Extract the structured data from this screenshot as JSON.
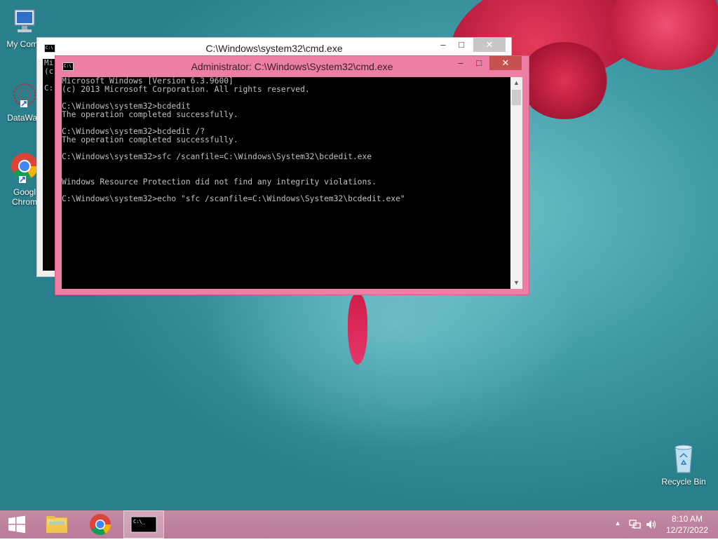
{
  "desktop": {
    "icons": [
      {
        "id": "my-computer",
        "label": "My Comp"
      },
      {
        "id": "datawag",
        "label": "DataWag"
      },
      {
        "id": "google-chrome",
        "label_line1": "Googl",
        "label_line2": "Chrom"
      },
      {
        "id": "recycle-bin",
        "label": "Recycle Bin"
      }
    ]
  },
  "back_window": {
    "title": "C:\\Windows\\system32\\cmd.exe",
    "lines": [
      "Mi",
      "(c",
      "",
      "C:"
    ],
    "controls": {
      "min": "–",
      "max": "□",
      "close": "✕"
    }
  },
  "front_window": {
    "title": "Administrator: C:\\Windows\\System32\\cmd.exe",
    "controls": {
      "min": "–",
      "max": "□",
      "close": "✕"
    },
    "console_lines": [
      "Microsoft Windows [Version 6.3.9600]",
      "(c) 2013 Microsoft Corporation. All rights reserved.",
      "",
      "C:\\Windows\\system32>bcdedit",
      "The operation completed successfully.",
      "",
      "C:\\Windows\\system32>bcdedit /?",
      "The operation completed successfully.",
      "",
      "C:\\Windows\\system32>sfc /scanfile=C:\\Windows\\System32\\bcdedit.exe",
      "",
      "",
      "Windows Resource Protection did not find any integrity violations.",
      "",
      "C:\\Windows\\system32>echo \"sfc /scanfile=C:\\Windows\\System32\\bcdedit.exe\""
    ]
  },
  "taskbar": {
    "clock_time": "8:10 AM",
    "clock_date": "12/27/2022",
    "tray_arrow": "▲"
  },
  "colors": {
    "accent": "#ec7fa3",
    "taskbar": "#be82a0",
    "console_bg": "#000000",
    "console_text": "#c0c0c0"
  }
}
